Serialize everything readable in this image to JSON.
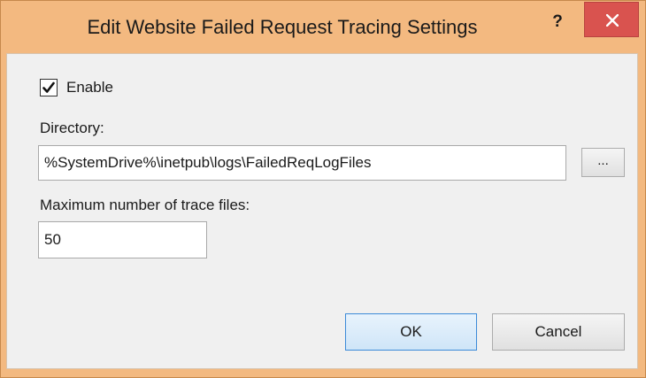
{
  "dialog": {
    "title": "Edit Website Failed Request Tracing Settings",
    "help_label": "?",
    "close_icon": "close-x-icon"
  },
  "enable": {
    "label": "Enable",
    "checked": true
  },
  "directory": {
    "label": "Directory:",
    "value": "%SystemDrive%\\inetpub\\logs\\FailedReqLogFiles",
    "browse_label": "..."
  },
  "max_trace_files": {
    "label": "Maximum number of trace files:",
    "value": "50"
  },
  "buttons": {
    "ok_label": "OK",
    "cancel_label": "Cancel"
  },
  "colors": {
    "title_bar": "#f3b980",
    "close_button": "#d9534f",
    "dialog_body": "#f0f0f0",
    "default_button_border": "#3c8ad8"
  }
}
